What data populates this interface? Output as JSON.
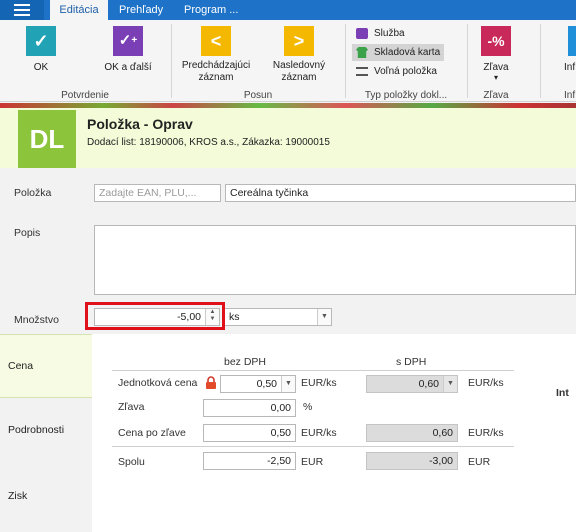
{
  "tabs": {
    "active": "Editácia",
    "t2": "Prehľady",
    "t3": "Program ..."
  },
  "ribbon": {
    "ok": "OK",
    "ok_next": "OK a ďalší",
    "prev_line1": "Predchádzajúci",
    "prev_line2": "záznam",
    "next_line1": "Nasledovný",
    "next_line2": "záznam",
    "item_service": "Služba",
    "item_stock": "Skladová karta",
    "item_free": "Voľná položka",
    "discount": "Zľava",
    "discount_arrow": "▾",
    "info": "Inf",
    "g_confirm": "Potvrdenie",
    "g_move": "Posun",
    "g_type": "Typ položky dokl...",
    "g_discount": "Zľava",
    "g_info": "Inf",
    "colors": {
      "ok": "#22a3b5",
      "ok_next": "#7b3fb5",
      "nav": "#f5b800",
      "discount": "#c8285a",
      "info": "#1e8fd8"
    }
  },
  "header": {
    "badge": "DL",
    "title": "Položka - Oprav",
    "subtitle": "Dodací list: 18190006, KROS a.s., Zákazka: 19000015"
  },
  "form": {
    "item_label": "Položka",
    "ean_placeholder": "Zadajte EAN, PLU,...",
    "item_name": "Cereálna tyčinka",
    "desc_label": "Popis",
    "qty_label": "Množstvo",
    "qty_value": "-5,00",
    "unit_value": "ks"
  },
  "sidenav": {
    "cena": "Cena",
    "podrobnosti": "Podrobnosti",
    "zisk": "Zisk"
  },
  "price": {
    "hdr_no_vat": "bez DPH",
    "hdr_vat": "s DPH",
    "unit_price_label": "Jednotková cena",
    "unit_price": "0,50",
    "unit_price_unit": "EUR/ks",
    "unit_price_vat": "0,60",
    "unit_price_vat_unit": "EUR/ks",
    "discount_label": "Zľava",
    "discount_value": "0,00",
    "discount_unit": "%",
    "after_label": "Cena po zľave",
    "after_value": "0,50",
    "after_unit": "EUR/ks",
    "after_vat": "0,60",
    "after_vat_unit": "EUR/ks",
    "total_label": "Spolu",
    "total_value": "-2,50",
    "total_unit": "EUR",
    "total_vat": "-3,00",
    "total_vat_unit": "EUR",
    "int_label": "Int"
  }
}
